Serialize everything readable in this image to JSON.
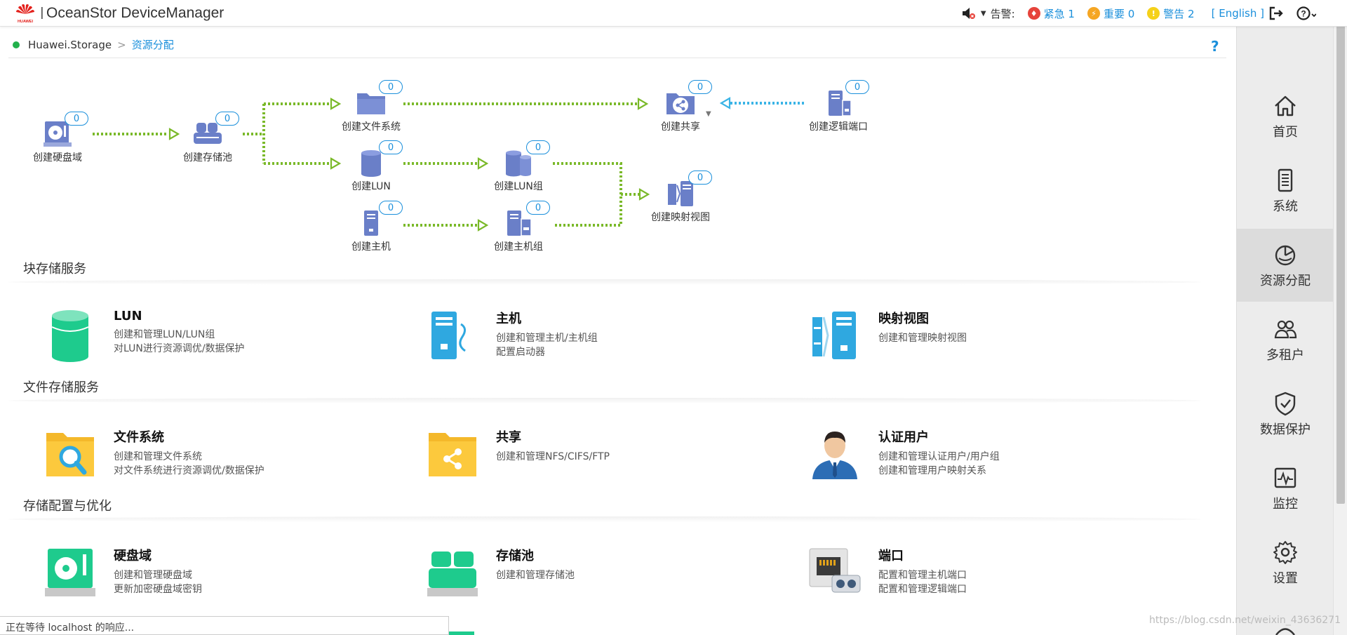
{
  "header": {
    "title": "OceanStor DeviceManager",
    "logo_name": "HUAWEI",
    "alarm_label": "告警:",
    "alarms": [
      {
        "label": "紧急 1",
        "color": "#e6433b",
        "icon": "critical-flame-icon"
      },
      {
        "label": "重要 0",
        "color": "#f5a623",
        "icon": "major-bolt-icon"
      },
      {
        "label": "警告 2",
        "color": "#f5d11a",
        "icon": "warning-exclaim-icon"
      }
    ],
    "language": "[ English ]"
  },
  "breadcrumb": {
    "root": "Huawei.Storage",
    "current": "资源分配",
    "help": "?"
  },
  "workflow": {
    "nodes": [
      {
        "id": "disk-domain",
        "label": "创建硬盘域",
        "count": "0"
      },
      {
        "id": "storage-pool",
        "label": "创建存储池",
        "count": "0"
      },
      {
        "id": "filesystem",
        "label": "创建文件系统",
        "count": "0"
      },
      {
        "id": "share",
        "label": "创建共享",
        "count": "0"
      },
      {
        "id": "logical-port",
        "label": "创建逻辑端口",
        "count": "0"
      },
      {
        "id": "lun",
        "label": "创建LUN",
        "count": "0"
      },
      {
        "id": "lun-group",
        "label": "创建LUN组",
        "count": "0"
      },
      {
        "id": "mapping-view",
        "label": "创建映射视图",
        "count": "0"
      },
      {
        "id": "host",
        "label": "创建主机",
        "count": "0"
      },
      {
        "id": "host-group",
        "label": "创建主机组",
        "count": "0"
      }
    ]
  },
  "sections": [
    {
      "title": "块存储服务",
      "cards": [
        {
          "title": "LUN",
          "lines": [
            "创建和管理LUN/LUN组",
            "对LUN进行资源调优/数据保护"
          ],
          "icon": "lun-icon"
        },
        {
          "title": "主机",
          "lines": [
            "创建和管理主机/主机组",
            "配置启动器"
          ],
          "icon": "host-icon"
        },
        {
          "title": "映射视图",
          "lines": [
            "创建和管理映射视图"
          ],
          "icon": "mapping-view-icon"
        }
      ]
    },
    {
      "title": "文件存储服务",
      "cards": [
        {
          "title": "文件系统",
          "lines": [
            "创建和管理文件系统",
            "对文件系统进行资源调优/数据保护"
          ],
          "icon": "filesystem-icon"
        },
        {
          "title": "共享",
          "lines": [
            "创建和管理NFS/CIFS/FTP"
          ],
          "icon": "share-icon"
        },
        {
          "title": "认证用户",
          "lines": [
            "创建和管理认证用户/用户组",
            "创建和管理用户映射关系"
          ],
          "icon": "auth-user-icon"
        }
      ]
    },
    {
      "title": "存储配置与优化",
      "cards": [
        {
          "title": "硬盘域",
          "lines": [
            "创建和管理硬盘域",
            "更新加密硬盘域密钥"
          ],
          "icon": "disk-domain-icon"
        },
        {
          "title": "存储池",
          "lines": [
            "创建和管理存储池"
          ],
          "icon": "storage-pool-icon"
        },
        {
          "title": "端口",
          "lines": [
            "配置和管理主机端口",
            "配置和管理逻辑端口"
          ],
          "icon": "port-icon"
        }
      ]
    }
  ],
  "rightnav": [
    {
      "label": "首页",
      "icon": "home-icon"
    },
    {
      "label": "系统",
      "icon": "system-icon"
    },
    {
      "label": "资源分配",
      "icon": "provisioning-icon",
      "active": true
    },
    {
      "label": "多租户",
      "icon": "multi-tenant-icon"
    },
    {
      "label": "数据保护",
      "icon": "data-protection-icon"
    },
    {
      "label": "监控",
      "icon": "monitor-icon"
    },
    {
      "label": "设置",
      "icon": "settings-icon"
    }
  ],
  "status_bar": "正在等待 localhost 的响应...",
  "watermark": "https://blog.csdn.net/weixin_43636271",
  "colors": {
    "accent": "#1a8fdb",
    "flow_green": "#7ab929",
    "flow_blue": "#3ab4e6",
    "node_purple": "#6a7fc8"
  }
}
